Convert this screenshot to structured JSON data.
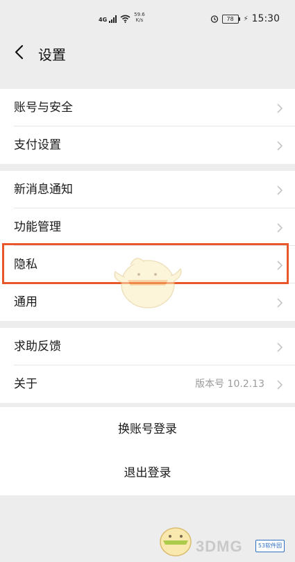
{
  "status_bar": {
    "network": "4G",
    "speed_value": "59.6",
    "speed_unit": "K/s",
    "battery": "78",
    "time": "15:30",
    "icons": [
      "signal-icon",
      "wifi-icon",
      "alarm-icon",
      "battery-icon",
      "charging-icon"
    ]
  },
  "header": {
    "title": "设置",
    "back_icon": "chevron-left-icon"
  },
  "groups": [
    {
      "items": [
        {
          "label": "账号与安全"
        },
        {
          "label": "支付设置"
        }
      ]
    },
    {
      "items": [
        {
          "label": "新消息通知"
        },
        {
          "label": "功能管理"
        },
        {
          "label": "隐私"
        },
        {
          "label": "通用"
        }
      ]
    },
    {
      "items": [
        {
          "label": "求助反馈"
        },
        {
          "label": "关于",
          "value": "版本号 10.2.13"
        }
      ]
    }
  ],
  "actions": {
    "switch_account": "换账号登录",
    "logout": "退出登录"
  },
  "annotation": {
    "highlight_color": "#e8572a",
    "highlighted_item": "隐私"
  },
  "watermark": {
    "text": "3DMG",
    "badge": "53软件园"
  }
}
